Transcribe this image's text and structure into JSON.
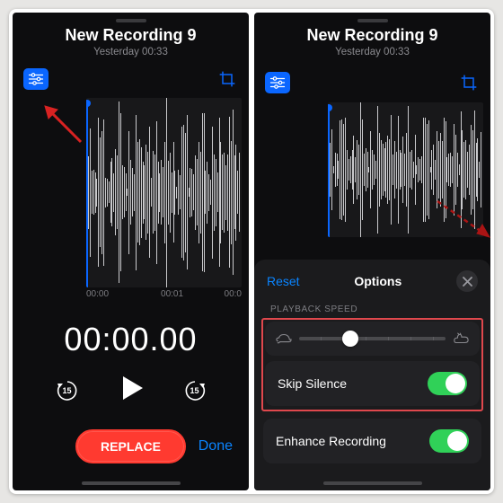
{
  "left": {
    "title": "New Recording 9",
    "subtitle": "Yesterday  00:33",
    "ticks": [
      "00:00",
      "00:01",
      "00:0"
    ],
    "timer": "00:00.00",
    "skipSeconds": "15",
    "replace": "REPLACE",
    "done": "Done"
  },
  "right": {
    "title": "New Recording 9",
    "subtitle": "Yesterday  00:33",
    "panel": {
      "reset": "Reset",
      "title": "Options",
      "section": "PLAYBACK SPEED",
      "skipSilence": "Skip Silence",
      "enhance": "Enhance Recording"
    }
  }
}
